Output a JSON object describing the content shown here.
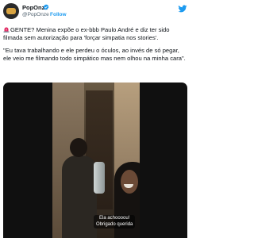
{
  "tweet": {
    "author_name": "PopOnze",
    "author_handle": "@PopOnze",
    "separator": "·",
    "follow_label": "Follow",
    "body_paragraph_1": "GENTE? Menina expõe o ex-bbb Paulo André e diz ter sido filmada sem autorização para 'forçar simpatia nos stories'.",
    "body_paragraph_2": "\"Eu tava trabalhando e ele perdeu o óculos, ao invés de só pegar, ele veio me filmando todo simpático mas nem olhou na minha cara\"."
  },
  "video": {
    "caption_line_1": "Ela achoooou!",
    "caption_line_2": "Obrigado querida"
  },
  "icons": {
    "verified": "verified-badge-icon",
    "twitter": "twitter-bird-icon",
    "siren": "siren-emoji-icon"
  },
  "colors": {
    "link": "#1d9bf0",
    "handle": "#536471",
    "text": "#0f1419",
    "siren": "#e0245e"
  }
}
